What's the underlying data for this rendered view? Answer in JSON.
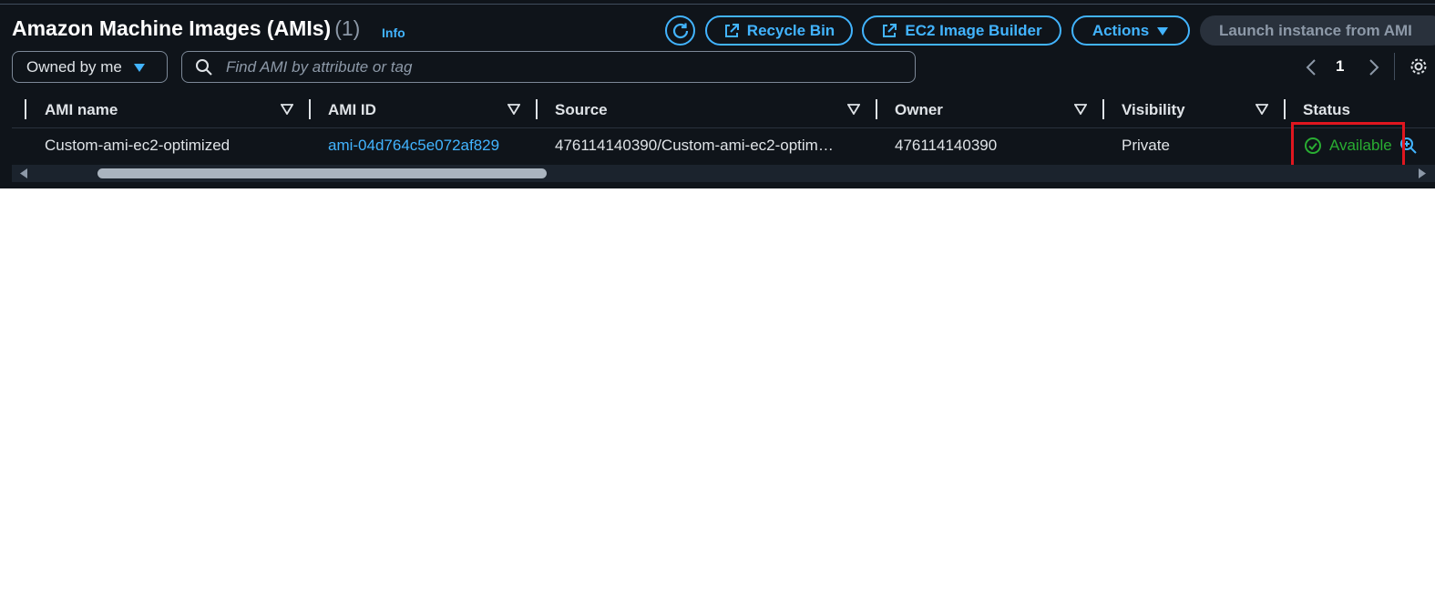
{
  "header": {
    "title": "Amazon Machine Images (AMIs)",
    "count": "(1)",
    "info": "Info"
  },
  "toolbar": {
    "recycle_bin": "Recycle Bin",
    "image_builder": "EC2 Image Builder",
    "actions": "Actions",
    "launch": "Launch instance from AMI"
  },
  "filter": {
    "owner_select": "Owned by me",
    "search_placeholder": "Find AMI by attribute or tag"
  },
  "pagination": {
    "current_page": "1"
  },
  "table": {
    "columns": [
      "AMI name",
      "AMI ID",
      "Source",
      "Owner",
      "Visibility",
      "Status"
    ],
    "rows": [
      {
        "ami_name": "Custom-ami-ec2-optimized",
        "ami_id": "ami-04d764c5e072af829",
        "source": "476114140390/Custom-ami-ec2-optim…",
        "owner": "476114140390",
        "visibility": "Private",
        "status": "Available"
      }
    ]
  },
  "colors": {
    "background": "#0f141a",
    "accent": "#42b4ff",
    "success": "#29ad32",
    "highlight": "#e0161f"
  },
  "icons": [
    "refresh-icon",
    "external-link-icon",
    "caret-down-icon",
    "search-icon",
    "chevron-left-icon",
    "chevron-right-icon",
    "gear-icon",
    "sort-icon",
    "check-circle-icon",
    "zoom-icon"
  ]
}
